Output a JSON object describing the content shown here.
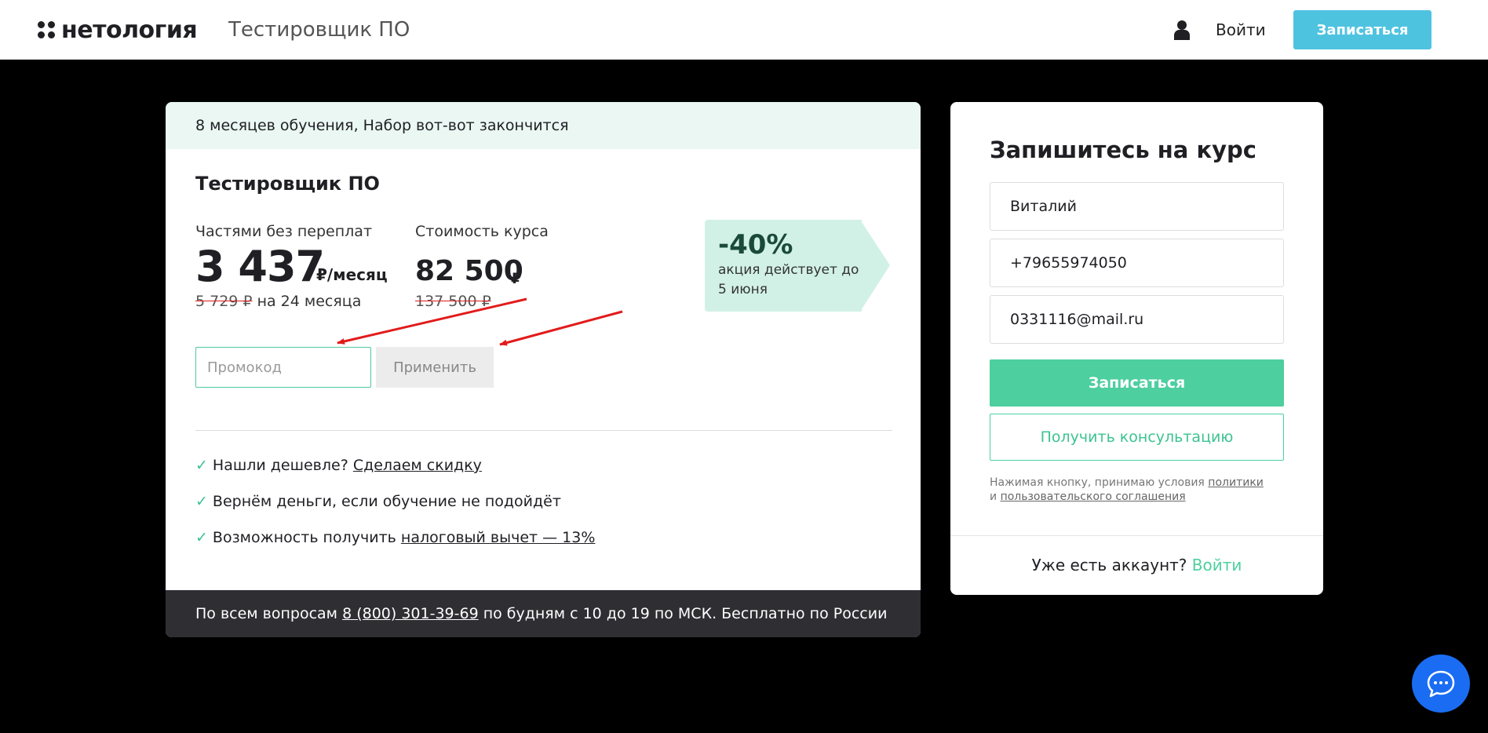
{
  "header": {
    "logo_text": "нетология",
    "course_title": "Тестировщик ПО",
    "login_label": "Войти",
    "signup_label": "Записаться"
  },
  "course_card": {
    "banner": "8 месяцев обучения, Набор вот-вот закончится",
    "title": "Тестировщик ПО",
    "installment_label": "Частями без переплат",
    "installment_price": "3 437",
    "installment_unit": "₽/месяц",
    "installment_old": "5 729 ₽",
    "installment_term": "на 24 месяца",
    "cost_label": "Стоимость курса",
    "cost_price": "82 500",
    "cost_currency": "₽",
    "cost_old": "137 500 ₽",
    "discount": {
      "percent": "-40%",
      "text": "акция действует до 5 июня"
    },
    "promo_placeholder": "Промокод",
    "apply_label": "Применить",
    "perks": [
      {
        "text": "Нашли дешевле?",
        "link": "Сделаем скидку"
      },
      {
        "text": "Вернём деньги, если обучение не подойдёт",
        "link": ""
      },
      {
        "text": "Возможность получить",
        "link": "налоговый вычет — 13%"
      }
    ],
    "footer": {
      "prefix": "По всем вопросам",
      "phone": "8 (800) 301-39-69",
      "suffix": "по будням с 10 до 19 по МСК. Бесплатно по России"
    }
  },
  "form": {
    "title": "Запишитесь на курс",
    "name_value": "Виталий",
    "phone_value": "+79655974050",
    "email_value": "0331116@mail.ru",
    "submit_label": "Записаться",
    "consult_label": "Получить консультацию",
    "terms_prefix": "Нажимая кнопку, принимаю условия",
    "terms_policy": "политики",
    "terms_and": "и",
    "terms_agreement": "пользовательского соглашения",
    "account_question": "Уже есть аккаунт?",
    "account_login": "Войти"
  },
  "colors": {
    "accent_green": "#4dcf9f",
    "accent_blue": "#4ec3e0",
    "chat_blue": "#1a6df3",
    "annotation_red": "#e21b1b"
  }
}
